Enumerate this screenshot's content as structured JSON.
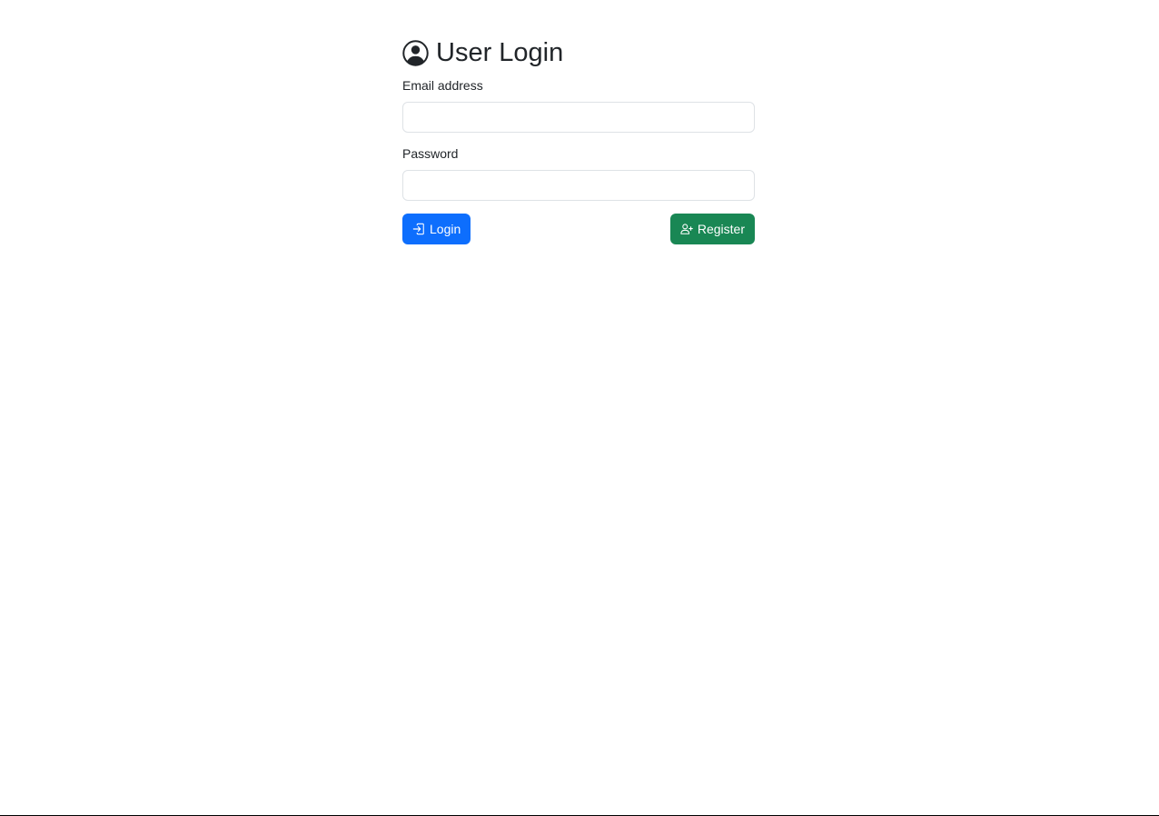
{
  "header": {
    "title": "User Login",
    "icon": "person-circle-icon"
  },
  "form": {
    "email_label": "Email address",
    "email_value": "",
    "password_label": "Password",
    "password_value": ""
  },
  "actions": {
    "login_label": "Login",
    "login_icon": "box-arrow-in-right-icon",
    "register_label": "Register",
    "register_icon": "person-plus-icon"
  },
  "colors": {
    "primary": "#0d6efd",
    "success": "#198754",
    "text": "#212529",
    "input_border": "#dee2e6"
  }
}
